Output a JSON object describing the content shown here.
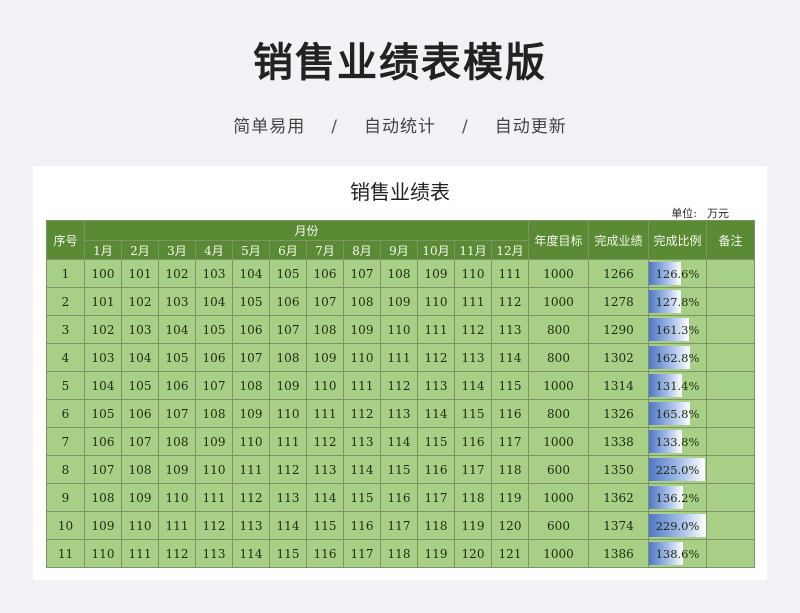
{
  "header": {
    "title": "销售业绩表模版",
    "taglines": [
      "简单易用",
      "自动统计",
      "自动更新"
    ],
    "separator": "/"
  },
  "sheet": {
    "title": "销售业绩表",
    "unit_label": "单位:",
    "unit_value": "万元",
    "columns": {
      "index": "序号",
      "month_group": "月份",
      "months": [
        "1月",
        "2月",
        "3月",
        "4月",
        "5月",
        "6月",
        "7月",
        "8月",
        "9月",
        "10月",
        "11月",
        "12月"
      ],
      "target": "年度目标",
      "achieved": "完成业绩",
      "ratio": "完成比例",
      "note": "备注"
    },
    "rows": [
      {
        "index": "1",
        "months": [
          "100",
          "101",
          "102",
          "103",
          "104",
          "105",
          "106",
          "107",
          "108",
          "109",
          "110",
          "111"
        ],
        "target": "1000",
        "achieved": "1266",
        "ratio": "126.6%",
        "ratio_value": 1.266,
        "note": ""
      },
      {
        "index": "2",
        "months": [
          "101",
          "102",
          "103",
          "104",
          "105",
          "106",
          "107",
          "108",
          "109",
          "110",
          "111",
          "112"
        ],
        "target": "1000",
        "achieved": "1278",
        "ratio": "127.8%",
        "ratio_value": 1.278,
        "note": ""
      },
      {
        "index": "3",
        "months": [
          "102",
          "103",
          "104",
          "105",
          "106",
          "107",
          "108",
          "109",
          "110",
          "111",
          "112",
          "113"
        ],
        "target": "800",
        "achieved": "1290",
        "ratio": "161.3%",
        "ratio_value": 1.613,
        "note": ""
      },
      {
        "index": "4",
        "months": [
          "103",
          "104",
          "105",
          "106",
          "107",
          "108",
          "109",
          "110",
          "111",
          "112",
          "113",
          "114"
        ],
        "target": "800",
        "achieved": "1302",
        "ratio": "162.8%",
        "ratio_value": 1.628,
        "note": ""
      },
      {
        "index": "5",
        "months": [
          "104",
          "105",
          "106",
          "107",
          "108",
          "109",
          "110",
          "111",
          "112",
          "113",
          "114",
          "115"
        ],
        "target": "1000",
        "achieved": "1314",
        "ratio": "131.4%",
        "ratio_value": 1.314,
        "note": ""
      },
      {
        "index": "6",
        "months": [
          "105",
          "106",
          "107",
          "108",
          "109",
          "110",
          "111",
          "112",
          "113",
          "114",
          "115",
          "116"
        ],
        "target": "800",
        "achieved": "1326",
        "ratio": "165.8%",
        "ratio_value": 1.658,
        "note": ""
      },
      {
        "index": "7",
        "months": [
          "106",
          "107",
          "108",
          "109",
          "110",
          "111",
          "112",
          "113",
          "114",
          "115",
          "116",
          "117"
        ],
        "target": "1000",
        "achieved": "1338",
        "ratio": "133.8%",
        "ratio_value": 1.338,
        "note": ""
      },
      {
        "index": "8",
        "months": [
          "107",
          "108",
          "109",
          "110",
          "111",
          "112",
          "113",
          "114",
          "115",
          "116",
          "117",
          "118"
        ],
        "target": "600",
        "achieved": "1350",
        "ratio": "225.0%",
        "ratio_value": 2.25,
        "note": ""
      },
      {
        "index": "9",
        "months": [
          "108",
          "109",
          "110",
          "111",
          "112",
          "113",
          "114",
          "115",
          "116",
          "117",
          "118",
          "119"
        ],
        "target": "1000",
        "achieved": "1362",
        "ratio": "136.2%",
        "ratio_value": 1.362,
        "note": ""
      },
      {
        "index": "10",
        "months": [
          "109",
          "110",
          "111",
          "112",
          "113",
          "114",
          "115",
          "116",
          "117",
          "118",
          "119",
          "120"
        ],
        "target": "600",
        "achieved": "1374",
        "ratio": "229.0%",
        "ratio_value": 2.29,
        "note": ""
      },
      {
        "index": "11",
        "months": [
          "110",
          "111",
          "112",
          "113",
          "114",
          "115",
          "116",
          "117",
          "118",
          "119",
          "120",
          "121"
        ],
        "target": "1000",
        "achieved": "1386",
        "ratio": "138.6%",
        "ratio_value": 1.386,
        "note": ""
      }
    ],
    "bar_max_ratio": 2.29,
    "bar_color": "#4f77c4",
    "cell_color": "#a8cf86",
    "header_color": "#5a8a34"
  }
}
